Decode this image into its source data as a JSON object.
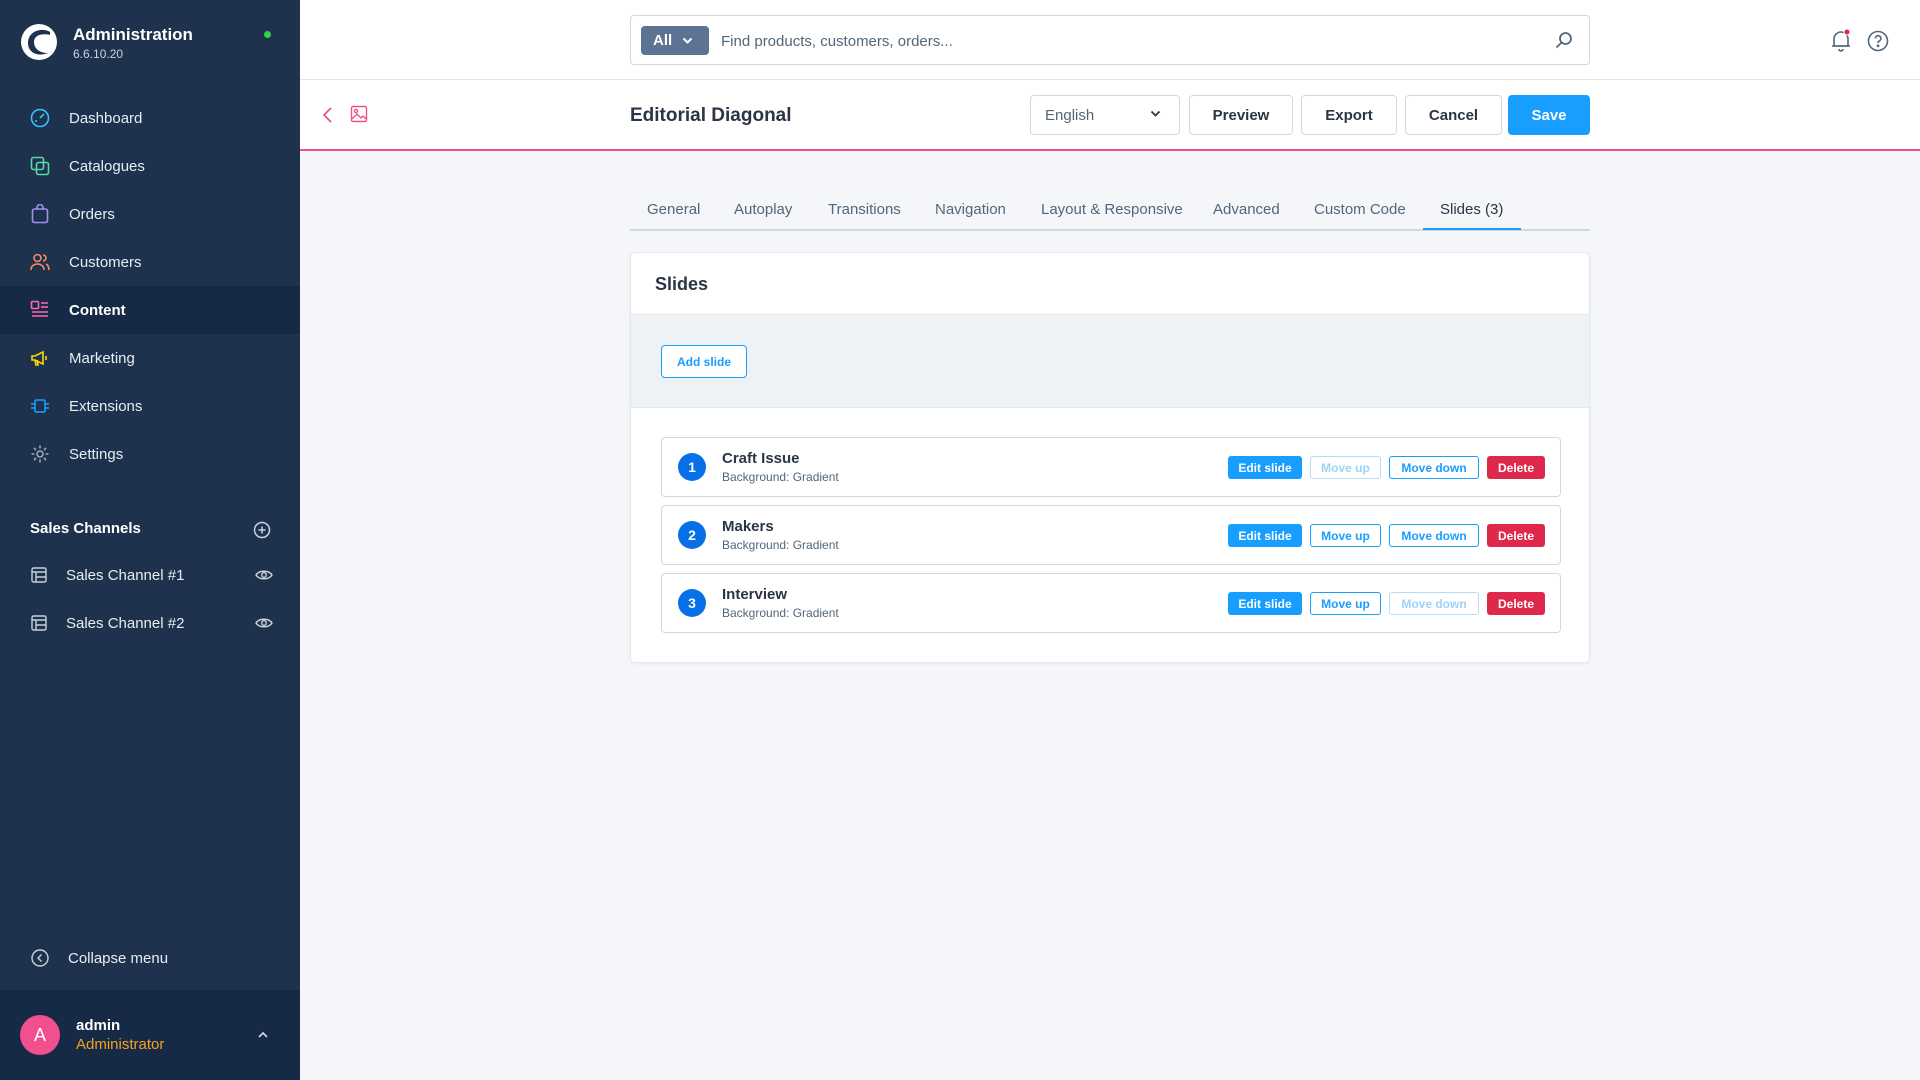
{
  "app": {
    "title": "Administration",
    "version": "6.6.10.20",
    "status_color": "#37d046"
  },
  "sidebar": {
    "items": [
      {
        "label": "Dashboard",
        "icon": "dashboard-icon",
        "color": "#33c3ff"
      },
      {
        "label": "Catalogues",
        "icon": "catalogues-icon",
        "color": "#57d9a3"
      },
      {
        "label": "Orders",
        "icon": "orders-icon",
        "color": "#a092f0"
      },
      {
        "label": "Customers",
        "icon": "customers-icon",
        "color": "#f88962"
      },
      {
        "label": "Content",
        "icon": "content-icon",
        "color": "#ff68b4",
        "active": true
      },
      {
        "label": "Marketing",
        "icon": "marketing-icon",
        "color": "#ffd700"
      },
      {
        "label": "Extensions",
        "icon": "extensions-icon",
        "color": "#189eff"
      },
      {
        "label": "Settings",
        "icon": "settings-icon",
        "color": "#9aa8b5"
      }
    ],
    "channels_title": "Sales Channels",
    "channels": [
      {
        "label": "Sales Channel #1"
      },
      {
        "label": "Sales Channel #2"
      }
    ],
    "collapse_label": "Collapse menu"
  },
  "user": {
    "initial": "A",
    "name": "admin",
    "role": "Administrator"
  },
  "search": {
    "scope": "All",
    "placeholder": "Find products, customers, orders..."
  },
  "header": {
    "title": "Editorial Diagonal",
    "language": "English",
    "preview_label": "Preview",
    "export_label": "Export",
    "cancel_label": "Cancel",
    "save_label": "Save"
  },
  "tabs": [
    {
      "label": "General"
    },
    {
      "label": "Autoplay"
    },
    {
      "label": "Transitions"
    },
    {
      "label": "Navigation"
    },
    {
      "label": "Layout & Responsive"
    },
    {
      "label": "Advanced"
    },
    {
      "label": "Custom Code"
    },
    {
      "label": "Slides (3)",
      "active": true
    }
  ],
  "slides_card": {
    "title": "Slides",
    "add_label": "Add slide",
    "edit_label": "Edit slide",
    "up_label": "Move up",
    "down_label": "Move down",
    "delete_label": "Delete",
    "slides": [
      {
        "number": "1",
        "name": "Craft Issue",
        "background": "Background: Gradient",
        "up_disabled": true,
        "down_disabled": false
      },
      {
        "number": "2",
        "name": "Makers",
        "background": "Background: Gradient",
        "up_disabled": false,
        "down_disabled": false
      },
      {
        "number": "3",
        "name": "Interview",
        "background": "Background: Gradient",
        "up_disabled": false,
        "down_disabled": true
      }
    ]
  },
  "colors": {
    "accent": "#189eff",
    "danger": "#de294c",
    "header_border": "#f0518e",
    "sidebar_bg": "#1f324d",
    "role": "#f6a123"
  }
}
